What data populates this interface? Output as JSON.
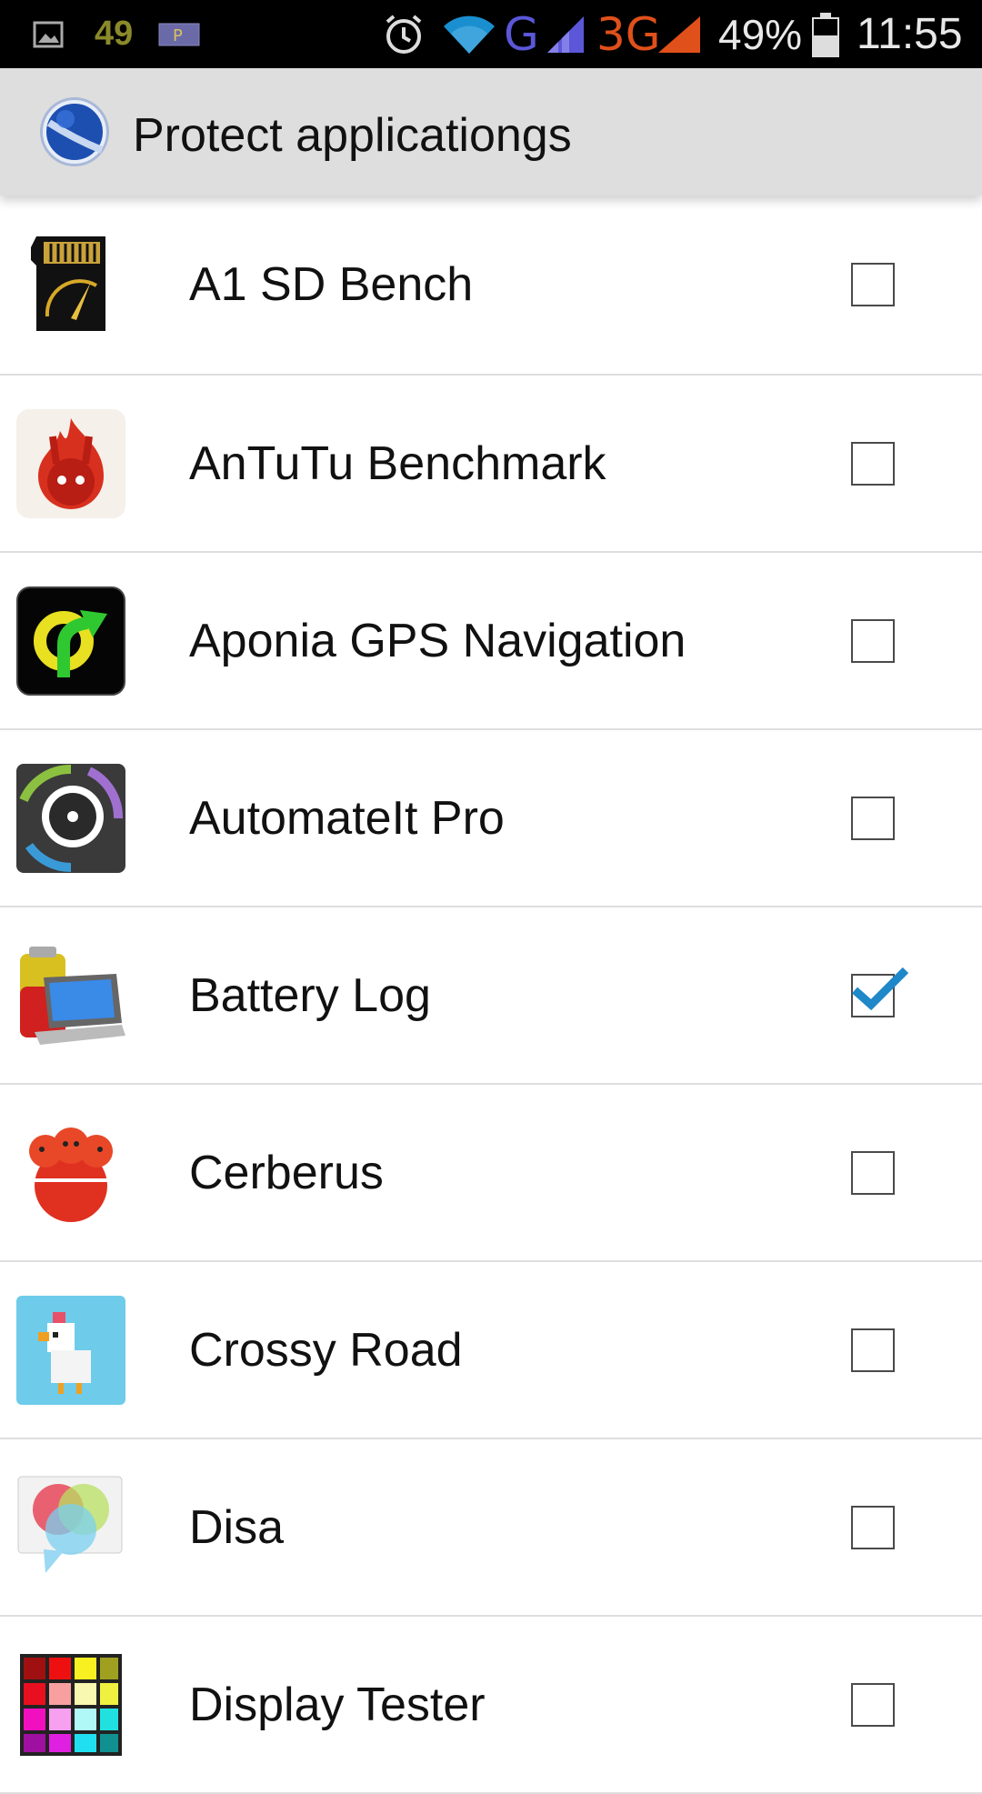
{
  "status_bar": {
    "left_number": "49",
    "battery_percent": "49%",
    "time": "11:55",
    "network_g": "G",
    "network_3g": "3G",
    "icons": [
      "image-icon",
      "parking-icon",
      "alarm-icon",
      "wifi-icon",
      "signal-icon",
      "battery-icon"
    ]
  },
  "header": {
    "title": "Protect applicationgs",
    "icon": "app-logo-icon"
  },
  "apps": [
    {
      "name": "A1 SD Bench",
      "checked": false,
      "icon": "sd-card-icon"
    },
    {
      "name": "AnTuTu Benchmark",
      "checked": false,
      "icon": "antutu-icon"
    },
    {
      "name": "Aponia GPS Navigation",
      "checked": false,
      "icon": "gps-navigation-icon"
    },
    {
      "name": "AutomateIt Pro",
      "checked": false,
      "icon": "automateit-icon"
    },
    {
      "name": "Battery Log",
      "checked": true,
      "icon": "battery-log-icon"
    },
    {
      "name": "Cerberus",
      "checked": false,
      "icon": "cerberus-icon"
    },
    {
      "name": "Crossy Road",
      "checked": false,
      "icon": "crossy-road-icon"
    },
    {
      "name": "Disa",
      "checked": false,
      "icon": "disa-icon"
    },
    {
      "name": "Display Tester",
      "checked": false,
      "icon": "display-tester-icon"
    }
  ],
  "colors": {
    "status_bar_bg": "#000000",
    "action_bar_bg": "#dedede",
    "check_accent": "#1e88c8",
    "divider": "#dedede"
  }
}
